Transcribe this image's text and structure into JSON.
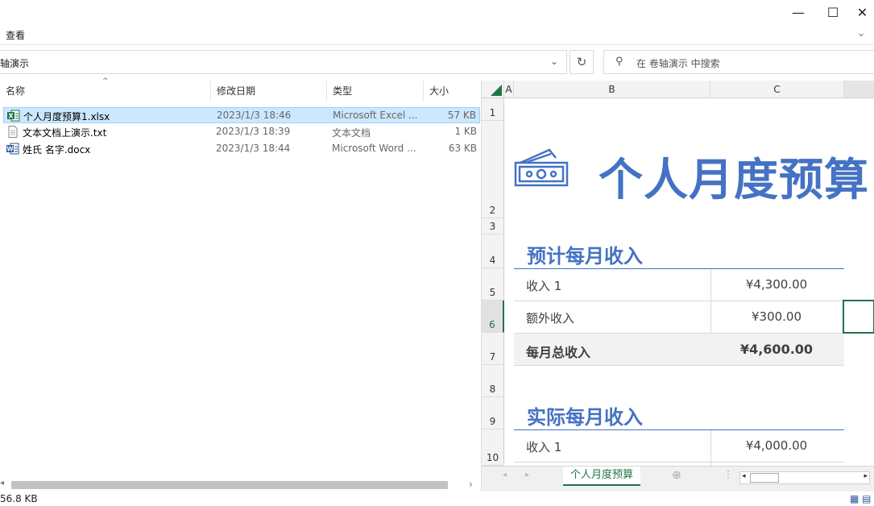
{
  "window": {
    "minimize": "—",
    "maximize": "☐",
    "close": "✕"
  },
  "ribbon": {
    "view_label": "查看"
  },
  "address": {
    "path": "轴演示",
    "refresh": "↻"
  },
  "search": {
    "placeholder": "在 卷轴演示 中搜索"
  },
  "columns": {
    "name": "名称",
    "date": "修改日期",
    "type": "类型",
    "size": "大小"
  },
  "files": [
    {
      "name": "个人月度预算1.xlsx",
      "date": "2023/1/3 18:46",
      "type": "Microsoft Excel ...",
      "size": "57 KB",
      "icon": "excel-file-icon",
      "selected": true
    },
    {
      "name": "文本文档上演示.txt",
      "date": "2023/1/3 18:39",
      "type": "文本文档",
      "size": "1 KB",
      "icon": "text-file-icon",
      "selected": false
    },
    {
      "name": "姓氏 名字.docx",
      "date": "2023/1/3 18:44",
      "type": "Microsoft Word ...",
      "size": "63 KB",
      "icon": "word-file-icon",
      "selected": false
    }
  ],
  "status": {
    "text": "56.8 KB"
  },
  "preview": {
    "col_headers": [
      "A",
      "B",
      "C"
    ],
    "row_headers": [
      "1",
      "2",
      "3",
      "4",
      "5",
      "6",
      "7",
      "8",
      "9",
      "10"
    ],
    "selected_row": "6",
    "title": "个人月度预算",
    "section1": {
      "title": "预计每月收入",
      "rows": [
        {
          "label": "收入 1",
          "amount": "¥4,300.00"
        },
        {
          "label": "额外收入",
          "amount": "¥300.00"
        },
        {
          "label": "每月总收入",
          "amount": "¥4,600.00"
        }
      ]
    },
    "section2": {
      "title": "实际每月收入",
      "rows": [
        {
          "label": "收入 1",
          "amount": "¥4,000.00"
        }
      ]
    },
    "sheet_tab": "个人月度预算",
    "accent": "#4472c4",
    "excel_green": "#217346"
  }
}
